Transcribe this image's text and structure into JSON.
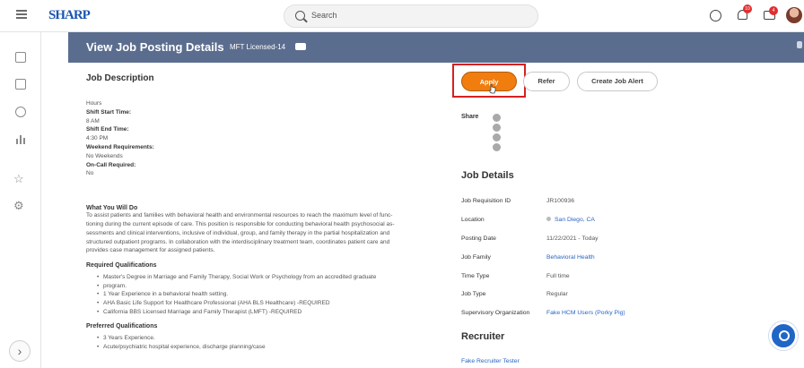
{
  "topbar": {
    "logo": "SHARP",
    "search_placeholder": "Search",
    "notifications_count": "10",
    "inbox_count": "4"
  },
  "header": {
    "title": "View Job Posting Details",
    "subtitle": "MFT Licensed-14"
  },
  "job_description": {
    "heading": "Job Description",
    "hours_label": "Hours",
    "shift_start_label": "Shift Start Time:",
    "shift_start_value": "8 AM",
    "shift_end_label": "Shift End Time:",
    "shift_end_value": "4:30 PM",
    "weekend_label": "Weekend Requirements:",
    "weekend_value": "No Weekends",
    "oncall_label": "On-Call Required:",
    "oncall_value": "No",
    "what_you_will_do_label": "What You Will Do",
    "what_you_will_do_lines": [
      "To assist patients and families with behavioral health and environmental resources to reach the maximum level of func-",
      "tioning during the current episode of care. This position is responsible for conducting behavioral health psychosocial as-",
      "sessments and clinical interventions, inclusive of individual, group, and family therapy in the partial hospitalization and",
      "structured outpatient programs. In collaboration with the interdisciplinary treatment team, coordinates patient care and",
      "provides case management for assigned patients."
    ],
    "required_label": "Required Qualifications",
    "required_items": [
      "Master's Degree in Marriage and Family Therapy, Social Work or Psychology from an accredited graduate",
      "program.",
      "1 Year Experience in a behavioral health setting.",
      "AHA Basic Life Support for Healthcare Professional (AHA BLS Healthcare) -REQUIRED",
      "California BBS Licensed Marriage and Family Therapist (LMFT) -REQUIRED"
    ],
    "preferred_label": "Preferred Qualifications",
    "preferred_items": [
      "3 Years Experience.",
      "Acute/psychiatric hospital experience, discharge planning/case"
    ]
  },
  "actions": {
    "apply": "Apply",
    "refer": "Refer",
    "create_alert": "Create Job Alert"
  },
  "share": {
    "label": "Share"
  },
  "job_details": {
    "heading": "Job Details",
    "rows": [
      {
        "label": "Job Requisition ID",
        "value": "JR100936"
      },
      {
        "label": "Location",
        "value": "San Diego, CA"
      },
      {
        "label": "Posting Date",
        "value": "11/22/2021 - Today"
      },
      {
        "label": "Job Family",
        "value": "Behavioral Health"
      },
      {
        "label": "Time Type",
        "value": "Full time"
      },
      {
        "label": "Job Type",
        "value": "Regular"
      },
      {
        "label": "Supervisory Organization",
        "value": "Fake HCM Users (Porky Pig)"
      }
    ]
  },
  "recruiter": {
    "heading": "Recruiter",
    "name": "Fake Recruiter Tester"
  },
  "colors": {
    "header_band": "#5b6d8f",
    "apply_orange": "#f07d0e",
    "highlight_red": "#d62020",
    "link_blue": "#2a64c5"
  }
}
